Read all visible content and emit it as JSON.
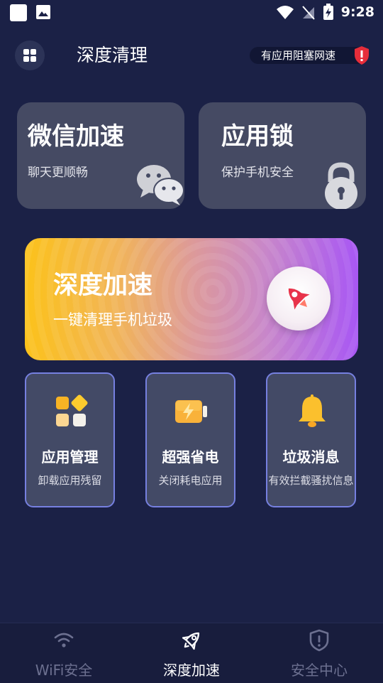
{
  "status_bar": {
    "time": "9:28"
  },
  "header": {
    "title": "深度清理",
    "warning_text": "有应用阻塞网速"
  },
  "cards": [
    {
      "title": "微信加速",
      "subtitle": "聊天更顺畅",
      "icon": "wechat-icon"
    },
    {
      "title": "应用锁",
      "subtitle": "保护手机安全",
      "icon": "padlock-icon"
    }
  ],
  "banner": {
    "title": "深度加速",
    "subtitle": "一键清理手机垃圾",
    "icon": "rocket-icon"
  },
  "features": [
    {
      "title": "应用管理",
      "subtitle": "卸载应用残留",
      "icon": "apps-grid-icon"
    },
    {
      "title": "超强省电",
      "subtitle": "关闭耗电应用",
      "icon": "battery-bolt-icon"
    },
    {
      "title": "垃圾消息",
      "subtitle": "有效拦截骚扰信息",
      "icon": "bell-icon"
    }
  ],
  "bottom_nav": [
    {
      "label": "WiFi安全",
      "icon": "wifi-icon",
      "active": false
    },
    {
      "label": "深度加速",
      "icon": "rocket-icon",
      "active": true
    },
    {
      "label": "安全中心",
      "icon": "shield-alert-icon",
      "active": false
    }
  ],
  "colors": {
    "background": "#1b2146",
    "card": "#454a63",
    "tile_border": "#7680e0",
    "banner_start": "#fcc21a",
    "banner_end": "#a857f4",
    "nav_active": "#ffffff",
    "nav_inactive": "#6c7090"
  }
}
